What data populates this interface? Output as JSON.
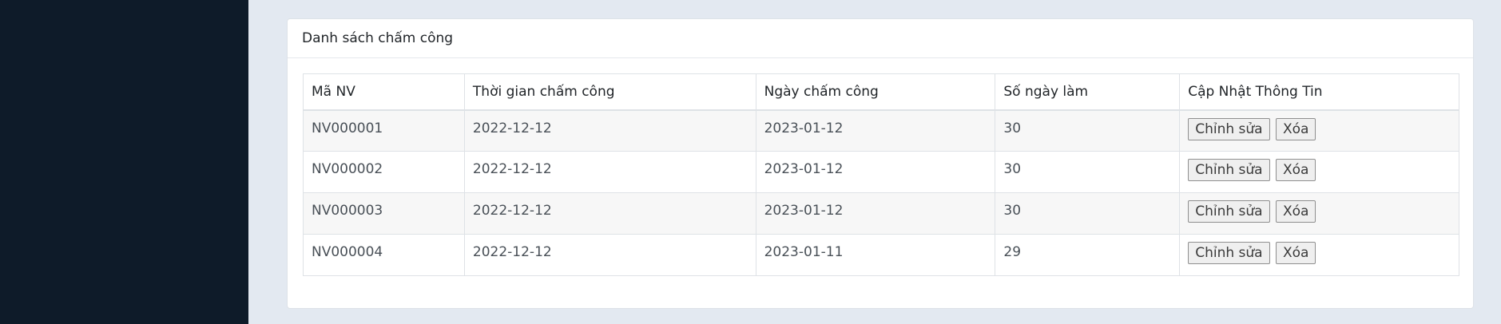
{
  "card": {
    "title": "Danh sách chấm công"
  },
  "table": {
    "headers": [
      "Mã NV",
      "Thời gian chấm công",
      "Ngày chấm công",
      "Số ngày làm",
      "Cập Nhật Thông Tin"
    ],
    "rows": [
      {
        "id": "NV000001",
        "time": "2022-12-12",
        "date": "2023-01-12",
        "days": "30"
      },
      {
        "id": "NV000002",
        "time": "2022-12-12",
        "date": "2023-01-12",
        "days": "30"
      },
      {
        "id": "NV000003",
        "time": "2022-12-12",
        "date": "2023-01-12",
        "days": "30"
      },
      {
        "id": "NV000004",
        "time": "2022-12-12",
        "date": "2023-01-11",
        "days": "29"
      }
    ],
    "edit_label": "Chỉnh sửa",
    "delete_label": "Xóa"
  }
}
